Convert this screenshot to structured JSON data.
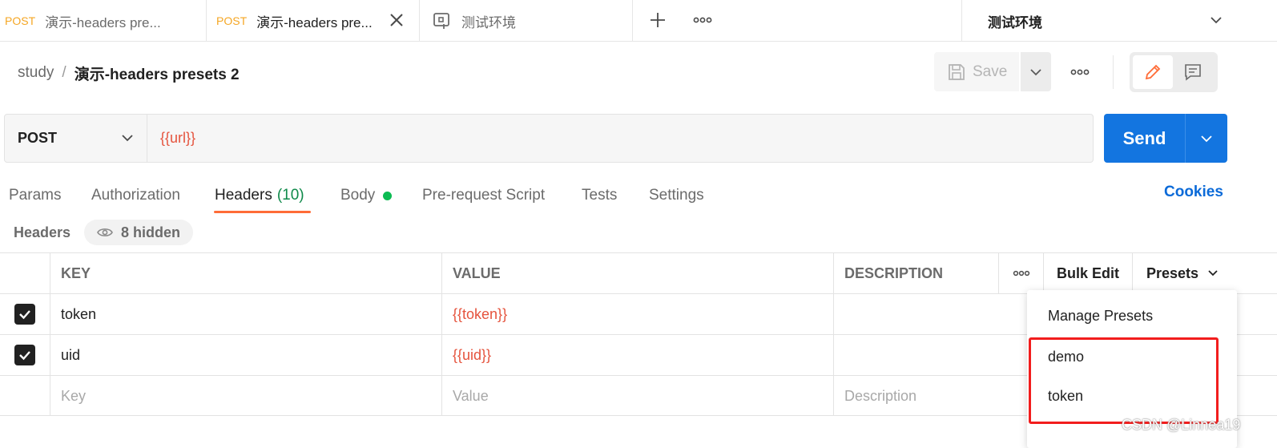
{
  "tabs": [
    {
      "method": "POST",
      "title": "演示-headers pre..."
    },
    {
      "method": "POST",
      "title": "演示-headers pre..."
    },
    {
      "title": "测试环境"
    }
  ],
  "environment": {
    "selected": "测试环境"
  },
  "breadcrumb": {
    "collection": "study",
    "separator": "/",
    "request": "演示-headers presets 2"
  },
  "toolbar": {
    "save_label": "Save"
  },
  "request": {
    "method": "POST",
    "url": "{{url}}",
    "send_label": "Send"
  },
  "request_tabs": {
    "params": "Params",
    "authorization": "Authorization",
    "headers": "Headers",
    "headers_count": "(10)",
    "body": "Body",
    "prerequest": "Pre-request Script",
    "tests": "Tests",
    "settings": "Settings",
    "cookies": "Cookies"
  },
  "headers_section": {
    "label": "Headers",
    "hidden": "8 hidden"
  },
  "table": {
    "columns": {
      "key": "KEY",
      "value": "VALUE",
      "description": "DESCRIPTION",
      "bulk_edit": "Bulk Edit",
      "presets": "Presets"
    },
    "rows": [
      {
        "checked": true,
        "key": "token",
        "value": "{{token}}",
        "description": ""
      },
      {
        "checked": true,
        "key": "uid",
        "value": "{{uid}}",
        "description": ""
      }
    ],
    "placeholders": {
      "key": "Key",
      "value": "Value",
      "description": "Description"
    }
  },
  "presets_menu": {
    "manage": "Manage Presets",
    "items": [
      "demo",
      "token"
    ]
  },
  "watermark": "CSDN @Linnea19",
  "colors": {
    "accent": "#ff6c37",
    "send": "#1375e0",
    "variable": "#e5533d",
    "highlight": "#f21d1d",
    "method_tab": "#f5a623"
  }
}
